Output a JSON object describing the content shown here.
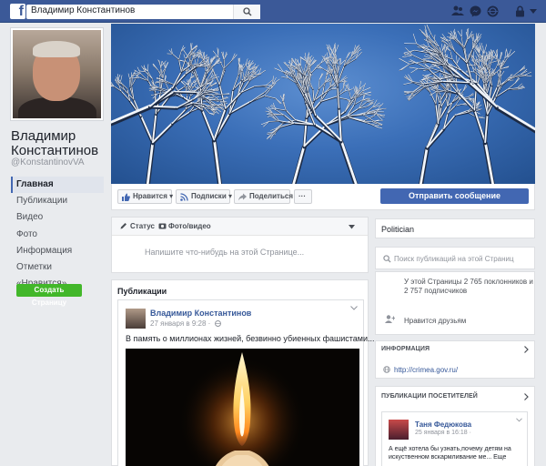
{
  "topbar": {
    "logo": "f",
    "search_value": "Владимир Константинов",
    "icons": [
      "friend-requests-icon",
      "messages-icon",
      "notifications-icon",
      "privacy-icon",
      "menu-icon"
    ]
  },
  "profile": {
    "name": "Владимир Константинов",
    "handle": "@KonstantinovVA"
  },
  "left_nav": {
    "items": [
      "Главная",
      "Публикации",
      "Видео",
      "Фото",
      "Информация",
      "Отметки «Нравится»"
    ],
    "active": "Главная",
    "create_page": "Создать Страницу"
  },
  "actions": {
    "like": "Нравится",
    "follow": "Подписки",
    "share": "Поделиться",
    "more": "···",
    "send_message": "Отправить сообщение"
  },
  "composer": {
    "tab_status": "Статус",
    "tab_photo": "Фото/видео",
    "placeholder": "Напишите что-нибудь на этой Странице..."
  },
  "publications": {
    "title": "Публикации",
    "post": {
      "author": "Владимир Константинов",
      "date": "27 января в 9:28 ·",
      "text": "В память о миллионах жизней, безвинно убиенных фашистами..."
    }
  },
  "right": {
    "category": "Politician",
    "search_placeholder": "Поиск публикаций на этой Страниц",
    "likes_text_1": "У этой Страницы 2 765 поклонников и",
    "likes_text_2": "2 757 подписчиков",
    "invite_friends": "Нравится друзьям",
    "info_header": "ИНФОРМАЦИЯ",
    "website": "http://crimea.gov.ru/",
    "visitor_posts_header": "ПУБЛИКАЦИИ ПОСЕТИТЕЛЕЙ",
    "visitor_post": {
      "author": "Таня Федюкова",
      "date": "25 января в 16:18 ·",
      "text_1": "А ещё хотела бы узнать,почему детям на",
      "text_2": "искуственном вскармливание ме... Еще"
    }
  },
  "colors": {
    "brand": "#3b5998",
    "button_blue": "#4267b2",
    "create_green": "#42b72a",
    "background": "#e9ebee"
  }
}
